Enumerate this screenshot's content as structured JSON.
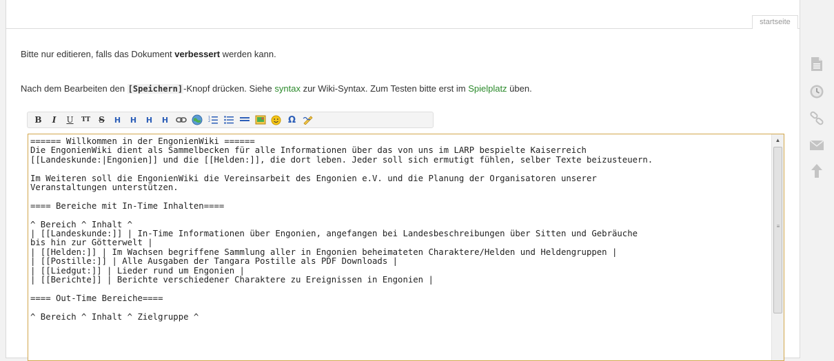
{
  "page_tab": {
    "label": "startseite"
  },
  "intro": {
    "line1_before": "Bitte nur editieren, falls das Dokument ",
    "line1_bold": "verbessert",
    "line1_after": " werden kann.",
    "line2_before": "Nach dem Bearbeiten den ",
    "line2_key": "[Speichern]",
    "line2_mid": "-Knopf drücken. Siehe ",
    "line2_link1": "syntax",
    "line2_mid2": " zur Wiki-Syntax. Zum Testen bitte erst im ",
    "line2_link2": "Spielplatz",
    "line2_after": " üben."
  },
  "toolbar": {
    "buttons": [
      {
        "name": "bold-button",
        "label": "B"
      },
      {
        "name": "italic-button",
        "label": "I"
      },
      {
        "name": "underline-button",
        "label": "U"
      },
      {
        "name": "monospace-button",
        "label": "TT"
      },
      {
        "name": "strikethrough-button",
        "label": "S"
      },
      {
        "name": "heading-same-button",
        "label": "H"
      },
      {
        "name": "heading-lower-button",
        "label": "H"
      },
      {
        "name": "heading-higher-button",
        "label": "H"
      },
      {
        "name": "headline-button",
        "label": "H"
      },
      {
        "name": "link-button",
        "icon": "link-icon"
      },
      {
        "name": "external-link-button",
        "icon": "globe-icon"
      },
      {
        "name": "ordered-list-button",
        "icon": "ordered-list-icon"
      },
      {
        "name": "unordered-list-button",
        "icon": "unordered-list-icon"
      },
      {
        "name": "horizontal-rule-button",
        "icon": "hr-icon"
      },
      {
        "name": "media-button",
        "icon": "image-icon"
      },
      {
        "name": "smiley-button",
        "icon": "smiley-icon"
      },
      {
        "name": "special-chars-button",
        "label": "Ω"
      },
      {
        "name": "signature-button",
        "icon": "signature-icon"
      }
    ]
  },
  "editor": {
    "content": "====== Willkommen in der EngonienWiki ======\nDie EngonienWiki dient als Sammelbecken für alle Informationen über das von uns im LARP bespielte Kaiserreich\n[[Landeskunde:|Engonien]] und die [[Helden:]], die dort leben. Jeder soll sich ermutigt fühlen, selber Texte beizusteuern.\n\nIm Weiteren soll die EngonienWiki die Vereinsarbeit des Engonien e.V. und die Planung der Organisatoren unserer\nVeranstaltungen unterstützen.\n\n==== Bereiche mit In-Time Inhalten====\n\n^ Bereich ^ Inhalt ^\n| [[Landeskunde:]] | In-Time Informationen über Engonien, angefangen bei Landesbeschreibungen über Sitten und Gebräuche\nbis hin zur Götterwelt |\n| [[Helden:]] | Im Wachsen begriffene Sammlung aller in Engonien beheimateten Charaktere/Helden und Heldengruppen |\n| [[Postille:]] | Alle Ausgaben der Tangara Postille als PDF Downloads |\n| [[Liedgut:]] | Lieder rund um Engonien |\n| [[Berichte]] | Berichte verschiedener Charaktere zu Ereignissen in Engonien |\n\n==== Out-Time Bereiche====\n\n^ Bereich ^ Inhalt ^ Zielgruppe ^"
  },
  "side_tools": [
    {
      "name": "show-page-icon",
      "icon": "document-icon"
    },
    {
      "name": "old-revisions-icon",
      "icon": "clock-icon"
    },
    {
      "name": "backlinks-icon",
      "icon": "link-icon"
    },
    {
      "name": "subscribe-icon",
      "icon": "envelope-icon"
    },
    {
      "name": "back-to-top-icon",
      "icon": "arrow-up-icon"
    }
  ],
  "colors": {
    "link": "#2b8a2b",
    "editor_border": "#d2a64c",
    "icon_grey": "#b7b7b7"
  }
}
